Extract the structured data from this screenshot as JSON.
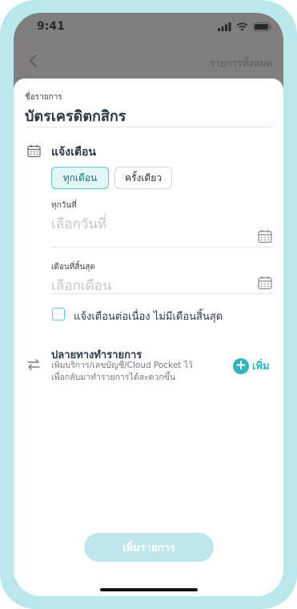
{
  "status_bar": {
    "time": "9:41"
  },
  "nav": {
    "all_items_label": "รายการทั้งหมด"
  },
  "item_name": {
    "label": "ชื่อรายการ",
    "value": "บัตรเครดิตกสิกร"
  },
  "notify": {
    "title": "แจ้งเตือน",
    "options": [
      "ทุกเดือน",
      "ครั้งเดียว"
    ],
    "selected": "ทุกเดือน"
  },
  "every_day": {
    "label": "ทุกวันที่",
    "placeholder": "เลือกวันที่"
  },
  "end_month": {
    "label": "เดือนที่สิ้นสุด",
    "placeholder": "เลือกเดือน"
  },
  "continuous": {
    "label": "แจ้งเตือนต่อเนื่อง ไม่มีเดือนสิ้นสุด",
    "checked": false
  },
  "destination": {
    "title": "ปลายทางทำรายการ",
    "desc_line1": "เพิ่มบริการ/เลขบัญชี/Cloud Pocket ไว้",
    "desc_line2": "เพื่อกลับมาทำรายการได้สะดวกขึ้น",
    "add_label": "เพิ่ม"
  },
  "submit_label": "เพิ่มรายการ",
  "colors": {
    "accent": "#34b4c0",
    "frame": "#b9e7ec",
    "header": "#7f7f7f",
    "submit_disabled": "#bfe6eb"
  }
}
